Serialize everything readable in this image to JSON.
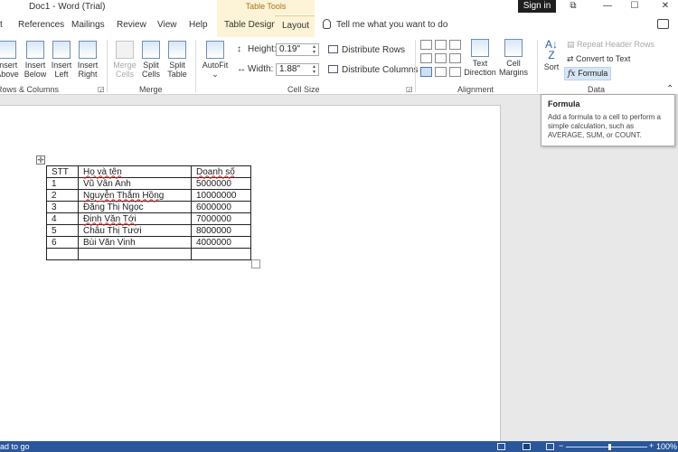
{
  "window": {
    "title": "Doc1  -  Word (Trial)",
    "context_tab_group": "Table Tools",
    "sign_in": "Sign in",
    "controls": [
      "⧉",
      "—",
      "☐",
      "✕"
    ]
  },
  "tabs": [
    {
      "label": "t",
      "active": false
    },
    {
      "label": "References",
      "active": false
    },
    {
      "label": "Mailings",
      "active": false
    },
    {
      "label": "Review",
      "active": false
    },
    {
      "label": "View",
      "active": false
    },
    {
      "label": "Help",
      "active": false
    },
    {
      "label": "Table Design",
      "active": false
    },
    {
      "label": "Layout",
      "active": true
    }
  ],
  "tell_me": "Tell me what you want to do",
  "ribbon": {
    "rows_columns": {
      "label": "Rows & Columns",
      "insert_above": [
        "Insert",
        "Above"
      ],
      "insert_below": [
        "Insert",
        "Below"
      ],
      "insert_left": [
        "Insert",
        "Left"
      ],
      "insert_right": [
        "Insert",
        "Right"
      ]
    },
    "merge": {
      "label": "Merge",
      "merge_cells": [
        "Merge",
        "Cells"
      ],
      "split_cells": [
        "Split",
        "Cells"
      ],
      "split_table": [
        "Split",
        "Table"
      ]
    },
    "cell_size": {
      "label": "Cell Size",
      "autofit": "AutoFit",
      "height_label": "Height:",
      "height_value": "0.19\"",
      "width_label": "Width:",
      "width_value": "1.88\"",
      "distribute_rows": "Distribute Rows",
      "distribute_columns": "Distribute Columns"
    },
    "alignment": {
      "label": "Alignment",
      "text_direction": [
        "Text",
        "Direction"
      ],
      "cell_margins": [
        "Cell",
        "Margins"
      ]
    },
    "data": {
      "label": "Data",
      "sort": "Sort",
      "repeat_header_rows": "Repeat Header Rows",
      "convert_to_text": "Convert to Text",
      "formula": "Formula"
    }
  },
  "tooltip": {
    "title": "Formula",
    "body": "Add a formula to a cell to perform a simple calculation, such as AVERAGE, SUM, or COUNT."
  },
  "table": {
    "header": [
      "STT",
      "Họ và tên",
      "Doanh số"
    ],
    "rows": [
      [
        "1",
        "Vũ Vân Anh",
        "5000000"
      ],
      [
        "2",
        "Nguyễn Thắm Hồng",
        "10000000"
      ],
      [
        "3",
        "Đặng Thị Ngọc",
        "6000000"
      ],
      [
        "4",
        "Đinh Văn Tới",
        "7000000"
      ],
      [
        "5",
        "Châu Thị Tươi",
        "8000000"
      ],
      [
        "6",
        "Bùi Văn Vinh",
        "4000000"
      ],
      [
        "",
        "",
        ""
      ]
    ]
  },
  "status": {
    "left": "ad to go",
    "zoom": "100%"
  }
}
